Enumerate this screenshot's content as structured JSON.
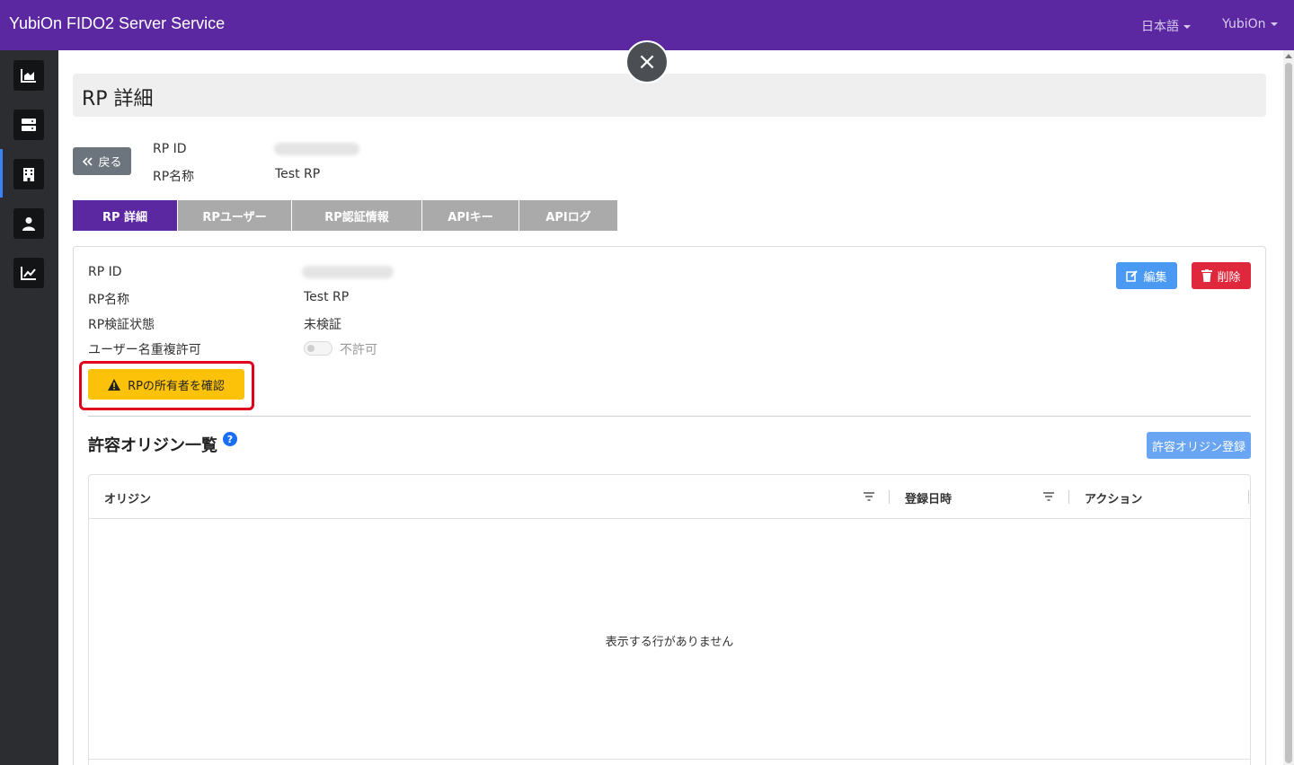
{
  "app": {
    "title": "YubiOn FIDO2 Server Service"
  },
  "header": {
    "language": "日本語",
    "user": "YubiOn"
  },
  "sidebar": {
    "items": [
      {
        "name": "dashboard",
        "icon": "area-chart-icon"
      },
      {
        "name": "servers",
        "icon": "server-icon",
        "active": true
      },
      {
        "name": "organization",
        "icon": "building-icon"
      },
      {
        "name": "users",
        "icon": "user-icon"
      },
      {
        "name": "statistics",
        "icon": "line-chart-icon"
      }
    ]
  },
  "page": {
    "title": "RP 詳細"
  },
  "back_button": {
    "label": "戻る"
  },
  "summary": {
    "rp_id_label": "RP ID",
    "rp_name_label": "RP名称",
    "rp_name_value": "Test RP"
  },
  "tabs": [
    {
      "label": "RP 詳細",
      "active": true
    },
    {
      "label": "RPユーザー"
    },
    {
      "label": "RP認証情報"
    },
    {
      "label": "APIキー"
    },
    {
      "label": "APIログ"
    }
  ],
  "detail": {
    "rp_id_label": "RP ID",
    "rp_name_label": "RP名称",
    "rp_name_value": "Test RP",
    "verify_label": "RP検証状態",
    "verify_value": "未検証",
    "dup_label": "ユーザー名重複許可",
    "dup_value": "不許可",
    "dup_enabled": false
  },
  "actions": {
    "edit_label": "編集",
    "delete_label": "削除"
  },
  "owner_button": {
    "label": "RPの所有者を確認"
  },
  "origins": {
    "title": "許容オリジン一覧",
    "help": "?",
    "register_label": "許容オリジン登録",
    "columns": [
      "オリジン",
      "登録日時",
      "アクション"
    ],
    "empty_message": "表示する行がありません"
  },
  "colors": {
    "brand": "#5b28a2",
    "warning": "#fcc20a",
    "danger": "#e0283d",
    "primary": "#4a9af4"
  }
}
